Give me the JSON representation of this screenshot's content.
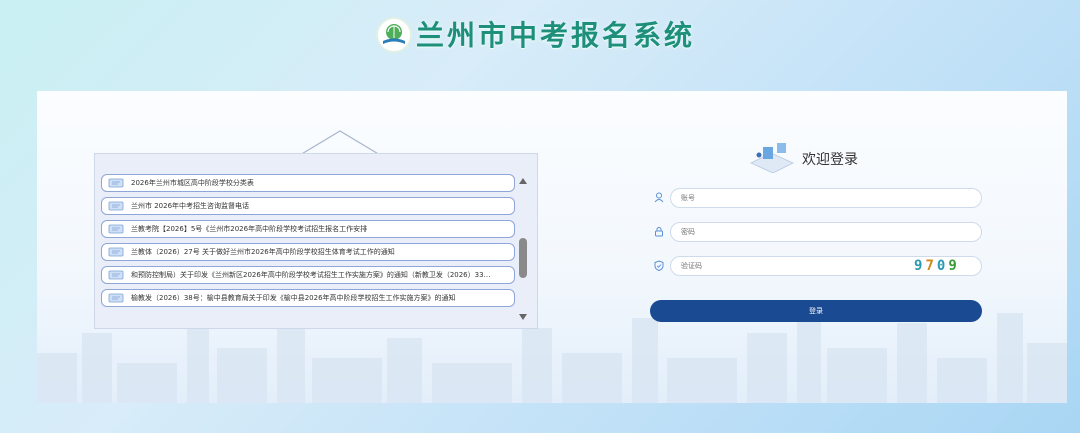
{
  "header": {
    "title": "兰州市中考报名系统",
    "logo_icon": "book-globe-logo-icon"
  },
  "notices": {
    "items": [
      {
        "text": "2026年兰州市城区高中阶段学校分类表"
      },
      {
        "text": "兰州市 2026年中考招生咨询监督电话"
      },
      {
        "text": "兰教考院【2026】5号《兰州市2026年高中阶段学校考试招生报名工作安排"
      },
      {
        "text": "兰教体（2026）27号 关于做好兰州市2026年高中阶段学校招生体育考试工作的通知"
      },
      {
        "text": "和预防控制局）关于印发《兰州新区2026年高中阶段学校考试招生工作实施方案》的通知（新教卫发（2026）33…"
      },
      {
        "text": "榆教发（2026）38号：榆中县教育局关于印发《榆中县2026年高中阶段学校招生工作实施方案》的通知"
      }
    ],
    "scroll_up_icon": "triangle-up-icon",
    "scroll_down_icon": "triangle-down-icon"
  },
  "login": {
    "title": "欢迎登录",
    "account_placeholder": "账号",
    "password_placeholder": "密码",
    "captcha_placeholder": "验证码",
    "captcha_digits": [
      "9",
      "7",
      "0",
      "9"
    ],
    "submit_label": "登录",
    "button_color": "#1a4a92"
  },
  "colors": {
    "title": "#1d8f7a",
    "notice_border": "#8fa6d8"
  }
}
